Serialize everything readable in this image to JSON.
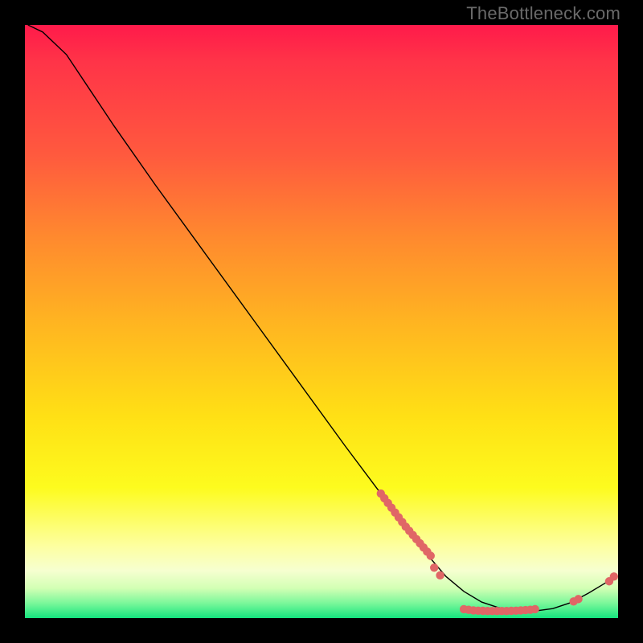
{
  "watermark": "TheBottleneck.com",
  "chart_data": {
    "type": "line",
    "title": "",
    "xlabel": "",
    "ylabel": "",
    "xlim": [
      0,
      100
    ],
    "ylim": [
      0,
      100
    ],
    "grid": false,
    "curve": [
      {
        "x": 0.5,
        "y": 100.0
      },
      {
        "x": 3.0,
        "y": 98.8
      },
      {
        "x": 7.0,
        "y": 95.0
      },
      {
        "x": 11.0,
        "y": 89.0
      },
      {
        "x": 15.0,
        "y": 83.0
      },
      {
        "x": 22.0,
        "y": 73.0
      },
      {
        "x": 30.0,
        "y": 62.0
      },
      {
        "x": 38.0,
        "y": 51.0
      },
      {
        "x": 46.0,
        "y": 40.0
      },
      {
        "x": 54.0,
        "y": 29.0
      },
      {
        "x": 60.0,
        "y": 21.0
      },
      {
        "x": 65.0,
        "y": 14.5
      },
      {
        "x": 68.0,
        "y": 10.5
      },
      {
        "x": 71.0,
        "y": 7.0
      },
      {
        "x": 74.0,
        "y": 4.5
      },
      {
        "x": 77.0,
        "y": 2.7
      },
      {
        "x": 80.0,
        "y": 1.7
      },
      {
        "x": 83.0,
        "y": 1.2
      },
      {
        "x": 86.0,
        "y": 1.2
      },
      {
        "x": 89.0,
        "y": 1.6
      },
      {
        "x": 92.0,
        "y": 2.6
      },
      {
        "x": 95.0,
        "y": 4.2
      },
      {
        "x": 98.0,
        "y": 6.0
      },
      {
        "x": 99.8,
        "y": 7.2
      }
    ],
    "markers_curve_a": [
      {
        "x": 60.0,
        "y": 21.0
      },
      {
        "x": 60.6,
        "y": 20.2
      },
      {
        "x": 61.2,
        "y": 19.4
      },
      {
        "x": 61.8,
        "y": 18.6
      },
      {
        "x": 62.4,
        "y": 17.8
      },
      {
        "x": 63.0,
        "y": 17.0
      },
      {
        "x": 63.6,
        "y": 16.2
      },
      {
        "x": 64.2,
        "y": 15.4
      },
      {
        "x": 64.8,
        "y": 14.7
      },
      {
        "x": 65.4,
        "y": 14.0
      },
      {
        "x": 66.0,
        "y": 13.3
      },
      {
        "x": 66.6,
        "y": 12.6
      },
      {
        "x": 67.2,
        "y": 11.9
      },
      {
        "x": 67.8,
        "y": 11.2
      },
      {
        "x": 68.4,
        "y": 10.5
      }
    ],
    "markers_curve_b": [
      {
        "x": 69.0,
        "y": 8.5
      },
      {
        "x": 70.0,
        "y": 7.2
      }
    ],
    "markers_bottom": [
      {
        "x": 74.0,
        "y": 1.5
      },
      {
        "x": 74.8,
        "y": 1.4
      },
      {
        "x": 75.6,
        "y": 1.3
      },
      {
        "x": 76.4,
        "y": 1.25
      },
      {
        "x": 77.2,
        "y": 1.22
      },
      {
        "x": 78.0,
        "y": 1.2
      },
      {
        "x": 78.8,
        "y": 1.2
      },
      {
        "x": 79.6,
        "y": 1.2
      },
      {
        "x": 80.4,
        "y": 1.2
      },
      {
        "x": 81.2,
        "y": 1.2
      },
      {
        "x": 82.0,
        "y": 1.22
      },
      {
        "x": 82.8,
        "y": 1.25
      },
      {
        "x": 83.6,
        "y": 1.3
      },
      {
        "x": 84.4,
        "y": 1.35
      },
      {
        "x": 85.2,
        "y": 1.4
      },
      {
        "x": 86.0,
        "y": 1.5
      }
    ],
    "markers_right": [
      {
        "x": 92.5,
        "y": 2.8
      },
      {
        "x": 93.3,
        "y": 3.2
      }
    ],
    "markers_far_right": [
      {
        "x": 98.5,
        "y": 6.2
      },
      {
        "x": 99.3,
        "y": 7.0
      }
    ],
    "marker_color": "#e06666",
    "curve_color": "#000000",
    "curve_width": 1.4
  }
}
